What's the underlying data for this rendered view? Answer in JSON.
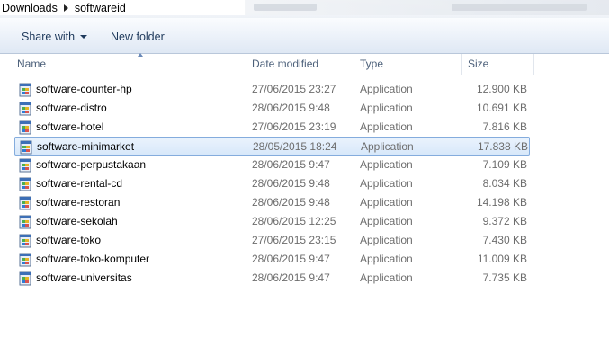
{
  "breadcrumb": {
    "items": [
      "Downloads",
      "softwareid"
    ]
  },
  "toolbar": {
    "share_label": "Share with",
    "new_folder_label": "New folder"
  },
  "columns": {
    "name": "Name",
    "date": "Date modified",
    "type": "Type",
    "size": "Size"
  },
  "files": [
    {
      "name": "software-counter-hp",
      "date": "27/06/2015 23:27",
      "type": "Application",
      "size": "12.900 KB"
    },
    {
      "name": "software-distro",
      "date": "28/06/2015 9:48",
      "type": "Application",
      "size": "10.691 KB"
    },
    {
      "name": "software-hotel",
      "date": "27/06/2015 23:19",
      "type": "Application",
      "size": "7.816 KB"
    },
    {
      "name": "software-minimarket",
      "date": "28/05/2015 18:24",
      "type": "Application",
      "size": "17.838 KB",
      "selected": true
    },
    {
      "name": "software-perpustakaan",
      "date": "28/06/2015 9:47",
      "type": "Application",
      "size": "7.109 KB"
    },
    {
      "name": "software-rental-cd",
      "date": "28/06/2015 9:48",
      "type": "Application",
      "size": "8.034 KB"
    },
    {
      "name": "software-restoran",
      "date": "28/06/2015 9:48",
      "type": "Application",
      "size": "14.198 KB"
    },
    {
      "name": "software-sekolah",
      "date": "28/06/2015 12:25",
      "type": "Application",
      "size": "9.372 KB"
    },
    {
      "name": "software-toko",
      "date": "27/06/2015 23:15",
      "type": "Application",
      "size": "7.430 KB"
    },
    {
      "name": "software-toko-komputer",
      "date": "28/06/2015 9:47",
      "type": "Application",
      "size": "11.009 KB"
    },
    {
      "name": "software-universitas",
      "date": "28/06/2015 9:47",
      "type": "Application",
      "size": "7.735 KB"
    }
  ],
  "icons": {
    "file": "application-exe-icon",
    "separator": "chevron-right-icon",
    "dropdown": "caret-down-icon",
    "sort": "sort-ascending-icon"
  },
  "colors": {
    "selection_border": "#84acdd",
    "selection_fill": "#d8e8fa",
    "command_text": "#1e395b"
  }
}
